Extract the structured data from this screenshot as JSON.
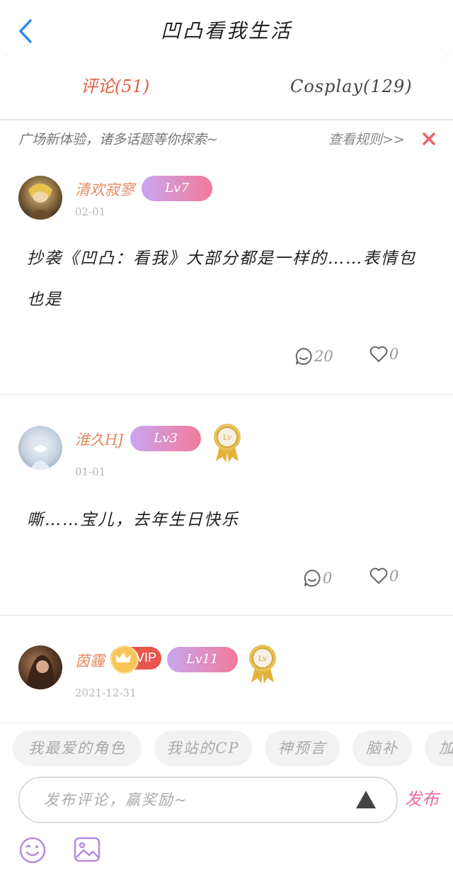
{
  "header": {
    "title": "凹凸看我生活"
  },
  "tabs": [
    {
      "label": "评论(51)",
      "active": true
    },
    {
      "label": "Cosplay(129)",
      "active": false
    }
  ],
  "notice": {
    "message": "广场新体验，诸多话题等你探索~",
    "rules_link": "查看规则>>"
  },
  "comments": [
    {
      "username": "清欢寂寥",
      "level": "Lv7",
      "date": "02-01",
      "text_line1": "抄袭《凹凸：看我》大部分都是一样的……表情包",
      "text_line2": "也是",
      "reply_count": "20",
      "like_count": "0",
      "has_medal": false
    },
    {
      "username": "淮久HJ",
      "level": "Lv3",
      "date": "01-01",
      "text_line1": "嘶……宝儿，去年生日快乐",
      "reply_count": "0",
      "like_count": "0",
      "has_medal": true
    },
    {
      "username": "茵霾",
      "vip": "VIP",
      "level": "Lv11",
      "date": "2021-12-31",
      "has_medal": true
    }
  ],
  "tags": [
    "我最爱的角色",
    "我站的CP",
    "神预言",
    "脑补",
    "加"
  ],
  "composer": {
    "placeholder": "发布评论，赢奖励~",
    "publish_label": "发布"
  },
  "colors": {
    "accent_orange": "#e06040",
    "username": "#e58a5c",
    "publish": "#ec6aa3",
    "back_icon": "#2f8fe6",
    "close_icon": "#e8626a"
  }
}
